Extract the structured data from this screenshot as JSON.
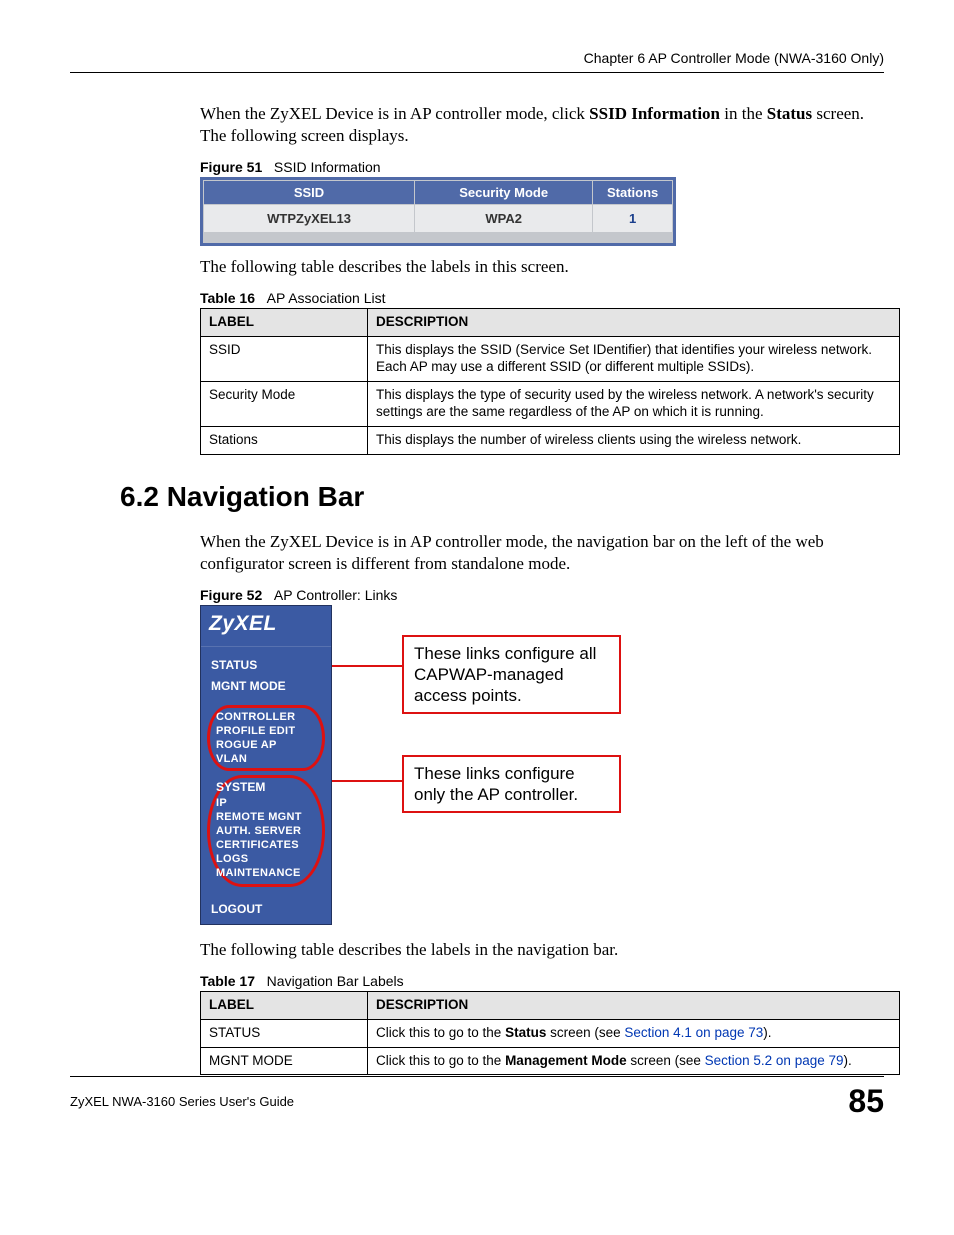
{
  "header": {
    "chapter": "Chapter 6 AP Controller Mode (NWA-3160 Only)"
  },
  "intro": {
    "p1_a": "When the ZyXEL Device is in AP controller mode, click ",
    "p1_b": "SSID Information",
    "p1_c": " in the ",
    "p1_d": "Status",
    "p1_e": " screen. The following screen displays."
  },
  "figure51": {
    "caption_prefix": "Figure 51",
    "caption_text": "SSID Information",
    "headers": {
      "ssid": "SSID",
      "sec": "Security Mode",
      "sta": "Stations"
    },
    "row": {
      "ssid": "WTPZyXEL13",
      "sec": "WPA2",
      "sta": "1"
    }
  },
  "after_fig51": "The following table describes the labels in this screen.",
  "table16": {
    "caption_prefix": "Table 16",
    "caption_text": "AP Association List",
    "headers": {
      "label": "LABEL",
      "desc": "DESCRIPTION"
    },
    "rows": [
      {
        "label": "SSID",
        "desc": "This displays the SSID (Service Set IDentifier) that identifies your wireless network. Each AP may use a different SSID (or different multiple SSIDs)."
      },
      {
        "label": "Security Mode",
        "desc": "This displays the type of security used by the wireless network. A network's security settings are the same regardless of the AP on which it is running."
      },
      {
        "label": "Stations",
        "desc": "This displays the number of wireless clients using the wireless network."
      }
    ]
  },
  "section62": {
    "heading": "6.2  Navigation Bar",
    "p1": "When the ZyXEL Device is in AP controller mode, the navigation bar on the left of the web configurator screen is different from standalone mode."
  },
  "figure52": {
    "caption_prefix": "Figure 52",
    "caption_text": "AP Controller: Links",
    "logo": "ZyXEL",
    "nav": {
      "status": "STATUS",
      "mgnt": "MGNT MODE",
      "group1": [
        "CONTROLLER",
        "PROFILE EDIT",
        "ROGUE AP",
        "VLAN"
      ],
      "group2_head": "SYSTEM",
      "group2": [
        "IP",
        "REMOTE MGNT",
        "AUTH. SERVER",
        "CERTIFICATES",
        "LOGS",
        "MAINTENANCE"
      ],
      "logout": "LOGOUT"
    },
    "callout1": "These links configure all CAPWAP-managed access points.",
    "callout2": "These links configure only the AP controller."
  },
  "after_fig52": "The following table describes the labels in the navigation bar.",
  "table17": {
    "caption_prefix": "Table 17",
    "caption_text": "Navigation Bar Labels",
    "headers": {
      "label": "LABEL",
      "desc": "DESCRIPTION"
    },
    "rows": {
      "status": {
        "label": "STATUS",
        "desc_a": "Click this to go to the ",
        "desc_b": "Status",
        "desc_c": " screen (see ",
        "desc_link": "Section 4.1 on page 73",
        "desc_d": ")."
      },
      "mgnt": {
        "label": "MGNT MODE",
        "desc_a": "Click this to go to the ",
        "desc_b": "Management Mode",
        "desc_c": " screen (see ",
        "desc_link": "Section 5.2 on page 79",
        "desc_d": ")."
      }
    }
  },
  "footer": {
    "guide": "ZyXEL NWA-3160 Series User's Guide",
    "page": "85"
  }
}
